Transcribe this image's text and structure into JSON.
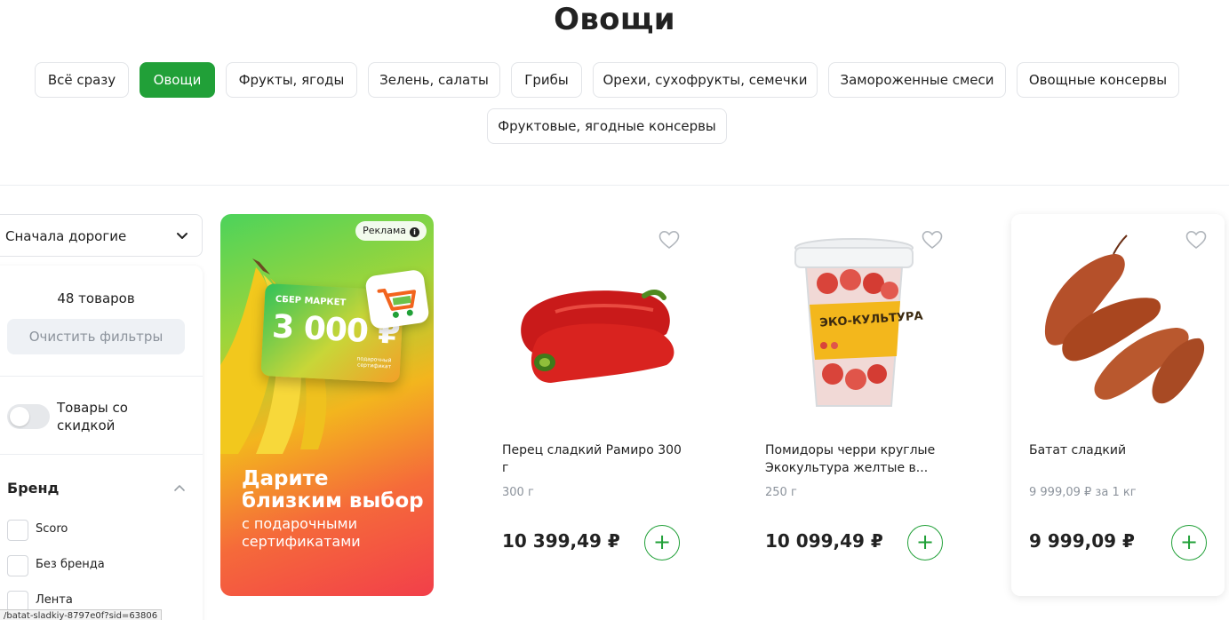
{
  "page_title": "Овощи",
  "categories": [
    {
      "label": "Всё сразу",
      "active": false
    },
    {
      "label": "Овощи",
      "active": true
    },
    {
      "label": "Фрукты, ягоды",
      "active": false
    },
    {
      "label": "Зелень, салаты",
      "active": false
    },
    {
      "label": "Грибы",
      "active": false
    },
    {
      "label": "Орехи, сухофрукты, семечки",
      "active": false
    },
    {
      "label": "Замороженные смеси",
      "active": false
    },
    {
      "label": "Овощные консервы",
      "active": false
    },
    {
      "label": "Фруктовые, ягодные консервы",
      "active": false
    }
  ],
  "sidebar": {
    "sort_label": "Сначала дорогие",
    "count_text": "48 товаров",
    "clear_filters": "Очистить фильтры",
    "discount_toggle_label": "Товары со скидкой",
    "discount_toggle_on": false,
    "brand_title": "Бренд",
    "brands": [
      "Scoro",
      "Без бренда",
      "Лента"
    ]
  },
  "status_url": "/batat-sladkiy-8797e0f?sid=63806",
  "ad": {
    "badge": "Реклама",
    "card_brand": "СБЕР МАРКЕТ",
    "card_amount": "3 000 ₽",
    "card_sub": "подарочный сертификат",
    "headline": "Дарите близким выбор",
    "text": "с подарочными сертификатами"
  },
  "products": [
    {
      "name": "Перец сладкий Рамиро 300 г",
      "weight": "300 г",
      "price": "10 399,49 ₽",
      "image": "red-peppers"
    },
    {
      "name": "Помидоры черри круглые Экокультура желтые в...",
      "weight": "250 г",
      "price": "10 099,49 ₽",
      "image": "cherry-tomatoes-cup",
      "cup_label": "ЭКО-КУЛЬТУРА"
    },
    {
      "name": "Батат сладкий",
      "weight": "9 999,09 ₽ за 1 кг",
      "price": "9 999,09 ₽",
      "image": "sweet-potatoes"
    }
  ],
  "colors": {
    "accent": "#21a038",
    "text": "#222222",
    "muted": "#8c939c"
  },
  "icons": {
    "favorite": "heart-outline-icon",
    "add": "plus-icon",
    "sort": "chevron-down-icon",
    "brand_collapse": "chevron-up-icon",
    "info": "info-icon"
  }
}
